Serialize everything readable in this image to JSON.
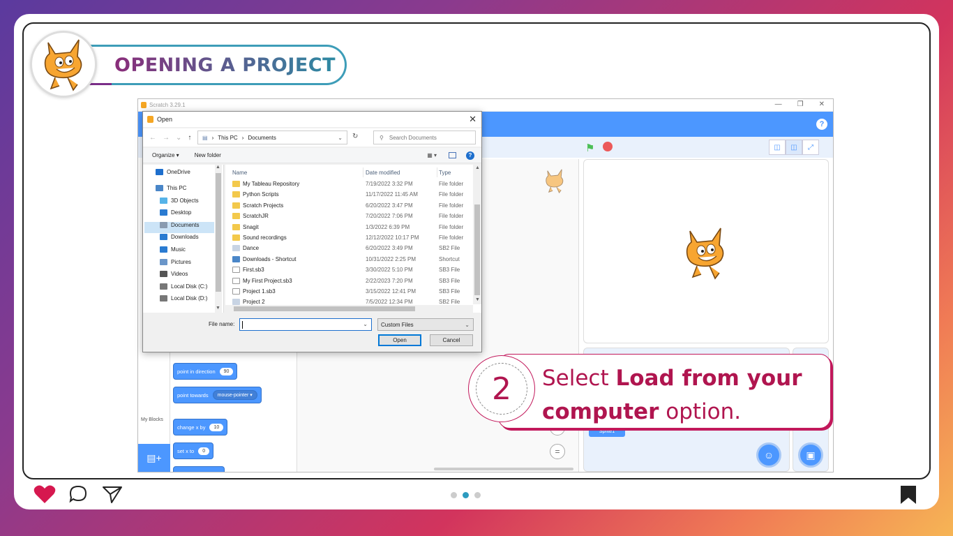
{
  "slide": {
    "title": "OPENING A PROJECT",
    "step_number": "2",
    "callout": {
      "pre": "Select ",
      "bold": "Load from your computer",
      "post": " option."
    },
    "carousel": {
      "active_index": 1,
      "count": 3
    }
  },
  "scratch": {
    "window_title": "Scratch 3.29.1",
    "help": "?",
    "my_blocks": "My Blocks",
    "blocks": [
      {
        "label": "point in direction",
        "value": "90"
      },
      {
        "label": "point towards",
        "dropdown": "mouse-pointer ▾"
      },
      {
        "label": "change x by",
        "value": "10"
      },
      {
        "label": "set x to",
        "value": "0"
      }
    ],
    "zoom_reset": "=",
    "sprite_label": "Sprite1"
  },
  "dialog": {
    "title": "Open",
    "breadcrumb": [
      "This PC",
      "Documents"
    ],
    "search_placeholder": "Search Documents",
    "organize": "Organize ▾",
    "new_folder": "New folder",
    "nav_tree": [
      {
        "label": "OneDrive",
        "color": "#1e6fcd"
      },
      {
        "label": "This PC",
        "color": "#4a86c8"
      },
      {
        "label": "3D Objects",
        "color": "#56b3e8"
      },
      {
        "label": "Desktop",
        "color": "#2a7bd1"
      },
      {
        "label": "Documents",
        "color": "#8a9bb0"
      },
      {
        "label": "Downloads",
        "color": "#2a7bd1"
      },
      {
        "label": "Music",
        "color": "#2a7bd1"
      },
      {
        "label": "Pictures",
        "color": "#6a96c9"
      },
      {
        "label": "Videos",
        "color": "#555"
      },
      {
        "label": "Local Disk (C:)",
        "color": "#777"
      },
      {
        "label": "Local Disk (D:)",
        "color": "#777"
      }
    ],
    "columns": {
      "name": "Name",
      "date": "Date modified",
      "type": "Type"
    },
    "files": [
      {
        "name": "My Tableau Repository",
        "date": "7/19/2022 3:32 PM",
        "type": "File folder",
        "kind": "folder"
      },
      {
        "name": "Python Scripts",
        "date": "11/17/2022 11:45 AM",
        "type": "File folder",
        "kind": "folder"
      },
      {
        "name": "Scratch Projects",
        "date": "6/20/2022 3:47 PM",
        "type": "File folder",
        "kind": "folder"
      },
      {
        "name": "ScratchJR",
        "date": "7/20/2022 7:06 PM",
        "type": "File folder",
        "kind": "folder"
      },
      {
        "name": "Snagit",
        "date": "1/3/2022 6:39 PM",
        "type": "File folder",
        "kind": "folder"
      },
      {
        "name": "Sound recordings",
        "date": "12/12/2022 10:17 PM",
        "type": "File folder",
        "kind": "folder"
      },
      {
        "name": "Dance",
        "date": "6/20/2022 3:49 PM",
        "type": "SB2 File",
        "kind": "sb2"
      },
      {
        "name": "Downloads - Shortcut",
        "date": "10/31/2022 2:25 PM",
        "type": "Shortcut",
        "kind": "shortcut"
      },
      {
        "name": "First.sb3",
        "date": "3/30/2022 5:10 PM",
        "type": "SB3 File",
        "kind": "file"
      },
      {
        "name": "My First Project.sb3",
        "date": "2/22/2023 7:20 PM",
        "type": "SB3 File",
        "kind": "file"
      },
      {
        "name": "Project 1.sb3",
        "date": "3/15/2022 12:41 PM",
        "type": "SB3 File",
        "kind": "file"
      },
      {
        "name": "Project 2",
        "date": "7/5/2022 12:34 PM",
        "type": "SB2 File",
        "kind": "sb2"
      }
    ],
    "file_name_label": "File name:",
    "file_name_value": "",
    "file_type": "Custom Files",
    "open_label": "Open",
    "cancel_label": "Cancel"
  },
  "colors": {
    "folder": "#f3c94b",
    "file": "#ffffff",
    "sb2": "#c8d4e4",
    "shortcut": "#4a86c8",
    "accent": "#c2185b",
    "scratch_blue": "#4c97ff"
  }
}
